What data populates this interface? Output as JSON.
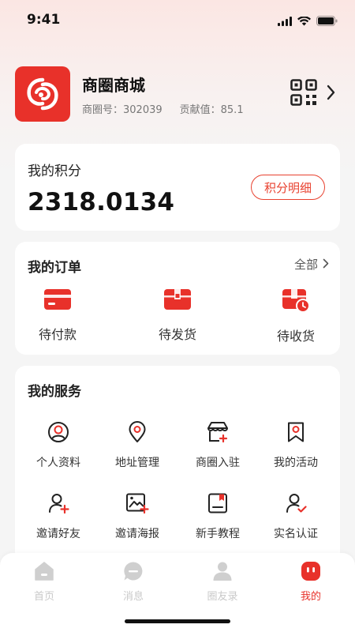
{
  "status_bar": {
    "time": "9:41"
  },
  "profile": {
    "shop_name": "商圈商城",
    "shop_id": "商圈号：302039",
    "contribution": "贡献值：85.1"
  },
  "points": {
    "title": "我的积分",
    "value": "2318.0134",
    "detail_button": "积分明细"
  },
  "orders": {
    "title": "我的订单",
    "all_link": "全部",
    "items": [
      {
        "label": "待付款",
        "icon": "wallet-icon"
      },
      {
        "label": "待发货",
        "icon": "package-icon"
      },
      {
        "label": "待收货",
        "icon": "box-clock-icon"
      }
    ]
  },
  "services": {
    "title": "我的服务",
    "items": [
      {
        "label": "个人资料",
        "icon": "user-circle-icon"
      },
      {
        "label": "地址管理",
        "icon": "location-pin-icon"
      },
      {
        "label": "商圈入驻",
        "icon": "store-add-icon"
      },
      {
        "label": "我的活动",
        "icon": "bookmark-icon"
      },
      {
        "label": "邀请好友",
        "icon": "user-add-icon"
      },
      {
        "label": "邀请海报",
        "icon": "image-add-icon"
      },
      {
        "label": "新手教程",
        "icon": "book-icon"
      },
      {
        "label": "实名认证",
        "icon": "user-check-icon"
      }
    ]
  },
  "tabbar": {
    "tabs": [
      {
        "label": "首页",
        "icon": "home-icon",
        "active": false
      },
      {
        "label": "消息",
        "icon": "chat-icon",
        "active": false
      },
      {
        "label": "圈友录",
        "icon": "contacts-icon",
        "active": false
      },
      {
        "label": "我的",
        "icon": "mine-icon",
        "active": true
      }
    ]
  },
  "colors": {
    "accent": "#e8312a",
    "inactive": "#c9c9c9",
    "background": "#f5f5f5"
  }
}
